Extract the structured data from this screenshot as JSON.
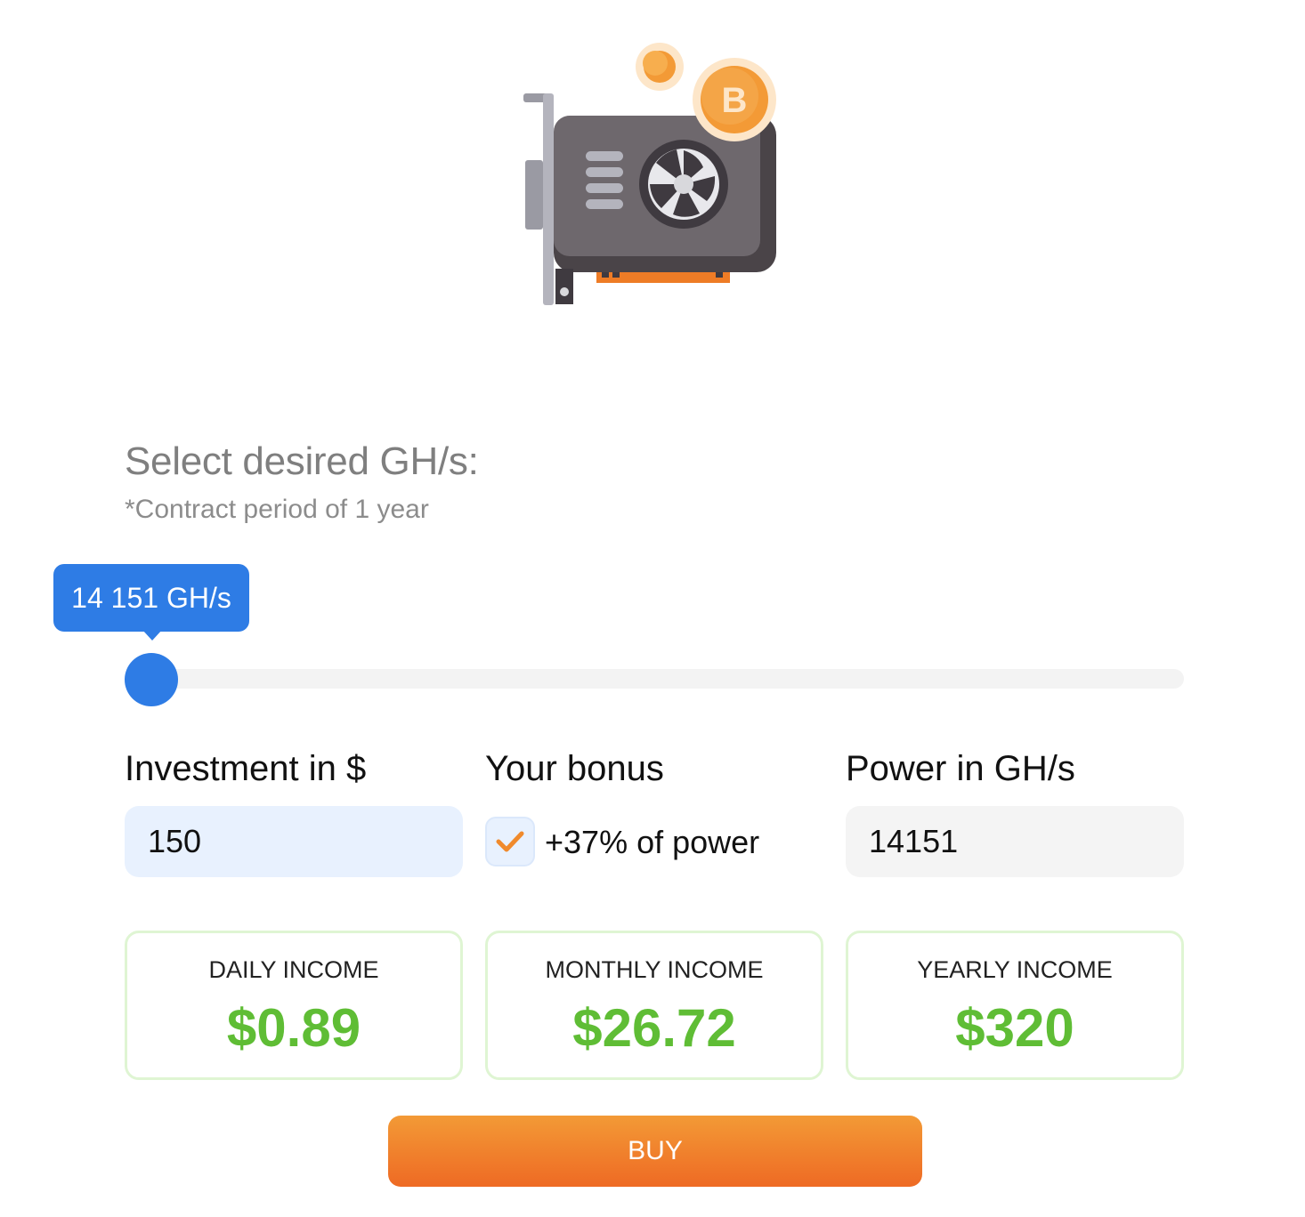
{
  "header": {
    "title": "Select desired GH/s:",
    "subtitle": "*Contract period of 1 year",
    "coin_symbol": "B"
  },
  "slider": {
    "tooltip": "14 151 GH/s",
    "level": 0.0,
    "accent_color": "#2e7ce5"
  },
  "fields": {
    "investment_label": "Investment in $",
    "investment_value": "150",
    "bonus_label": "Your bonus",
    "bonus_text": "+37% of power",
    "bonus_checked": true,
    "power_label": "Power in GH/s",
    "power_value": "14151"
  },
  "income": [
    {
      "label": "DAILY INCOME",
      "value": "$0.89"
    },
    {
      "label": "MONTHLY INCOME",
      "value": "$26.72"
    },
    {
      "label": "YEARLY INCOME",
      "value": "$320"
    }
  ],
  "buy_label": "BUY",
  "colors": {
    "income_green": "#5fbd35",
    "buy_orange": "#ee6a24",
    "investment_bg": "#e8f1fe"
  },
  "icons": {
    "illustration": "gpu-mining-card-icon",
    "coin": "bitcoin-coin-icon",
    "checkbox": "checkmark-icon"
  }
}
